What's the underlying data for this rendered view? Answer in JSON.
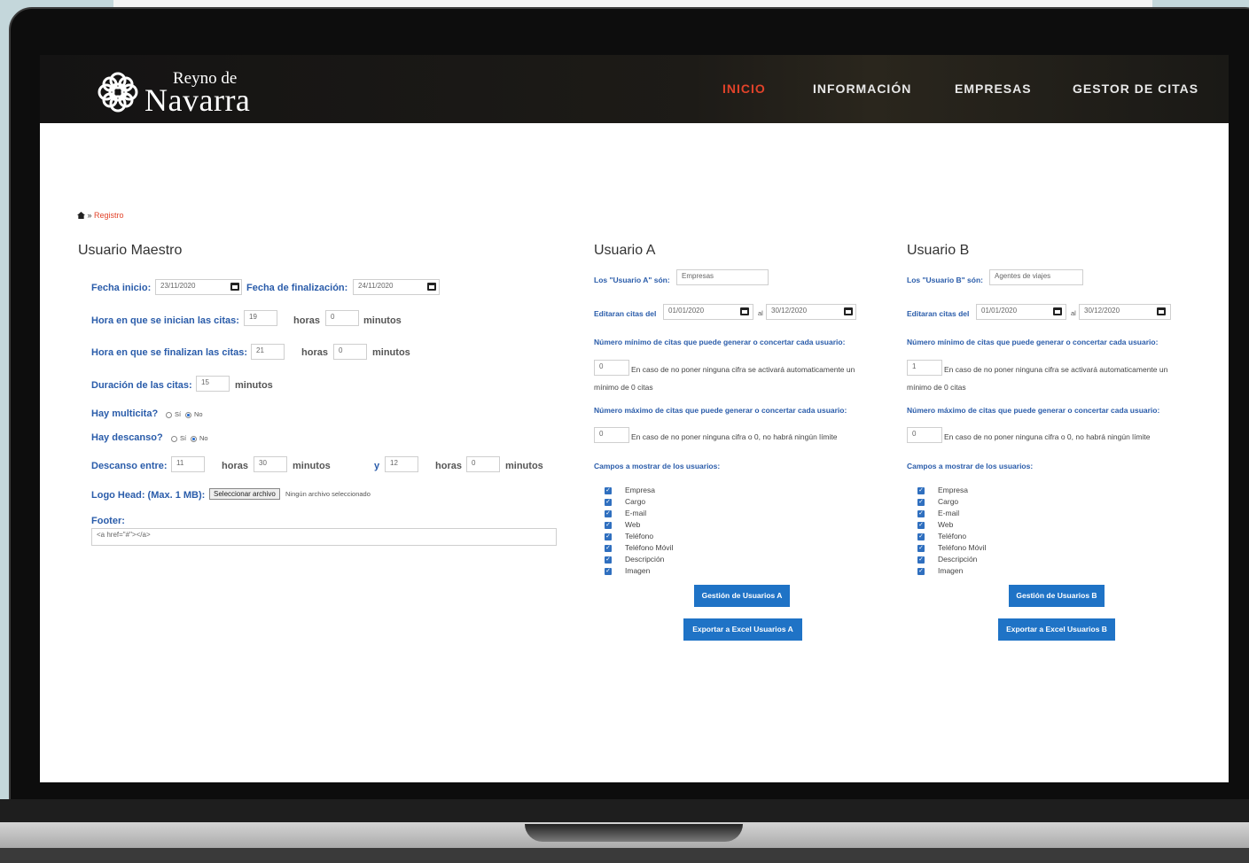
{
  "nav": {
    "logo_top": "Reyno de",
    "logo_bottom": "Navarra",
    "items": [
      "INICIO",
      "INFORMACIÓN",
      "EMPRESAS",
      "GESTOR DE CITAS"
    ]
  },
  "breadcrumb": {
    "separator": "»",
    "current": "Registro"
  },
  "maestro": {
    "title": "Usuario Maestro",
    "fecha_inicio_label": "Fecha inicio:",
    "fecha_inicio": "23/11/2020",
    "fecha_fin_label": "Fecha de finalización:",
    "fecha_fin": "24/11/2020",
    "hora_inicio_label": "Hora en que se inician las citas:",
    "hora_inicio_h": "19",
    "hora_inicio_m": "0",
    "hora_fin_label": "Hora en que se finalizan las citas:",
    "hora_fin_h": "21",
    "hora_fin_m": "0",
    "horas": "horas",
    "minutos": "minutos",
    "duracion_label": "Duración de las citas:",
    "duracion": "15",
    "multicita_label": "Hay multicita?",
    "descanso_label": "Hay descanso?",
    "si": "Sí",
    "no": "No",
    "descanso_entre_label": "Descanso entre:",
    "descanso_h1": "11",
    "descanso_m1": "30",
    "y": "y",
    "descanso_h2": "12",
    "descanso_m2": "0",
    "logo_label": "Logo Head: (Max. 1 MB):",
    "file_button": "Seleccionar archivo",
    "file_status": "Ningún archivo seleccionado",
    "footer_label": "Footer:",
    "footer_value": "<a href=\"#\"></a>"
  },
  "usuario_a": {
    "title": "Usuario A",
    "son_label": "Los \"Usuario A\" són:",
    "son_value": "Empresas",
    "editaran_label": "Editaran citas del",
    "desde": "01/01/2020",
    "al": "al",
    "hasta": "30/12/2020",
    "min_label": "Número mínimo de citas que puede generar o concertar cada usuario:",
    "min_value": "0",
    "min_note1": "En caso de no poner ninguna cifra se activará automaticamente un",
    "min_note2": "mínimo de 0 citas",
    "max_label": "Número máximo de citas que puede generar o concertar cada usuario:",
    "max_value": "0",
    "max_note": "En caso de no poner ninguna cifra o 0, no habrá ningún límite",
    "campos_label": "Campos a mostrar de los usuarios:",
    "campos": [
      "Empresa",
      "Cargo",
      "E-mail",
      "Web",
      "Teléfono",
      "Teléfono Móvil",
      "Descripción",
      "Imagen"
    ],
    "btn_gestion": "Gestión de Usuarios A",
    "btn_exportar": "Exportar a Excel Usuarios A"
  },
  "usuario_b": {
    "title": "Usuario B",
    "son_label": "Los \"Usuario B\" són:",
    "son_value": "Agentes de viajes",
    "editaran_label": "Editaran citas del",
    "desde": "01/01/2020",
    "al": "al",
    "hasta": "30/12/2020",
    "min_label": "Número mínimo de citas que puede generar o concertar cada usuario:",
    "min_value": "1",
    "min_note1": "En caso de no poner ninguna cifra se activará automaticamente un",
    "min_note2": "mínimo de 0 citas",
    "max_label": "Número máximo de citas que puede generar o concertar cada usuario:",
    "max_value": "0",
    "max_note": "En caso de no poner ninguna cifra o 0, no habrá ningún límite",
    "campos_label": "Campos a mostrar de los usuarios:",
    "campos": [
      "Empresa",
      "Cargo",
      "E-mail",
      "Web",
      "Teléfono",
      "Teléfono Móvil",
      "Descripción",
      "Imagen"
    ],
    "btn_gestion": "Gestión de Usuarios B",
    "btn_exportar": "Exportar a Excel Usuarios B"
  }
}
